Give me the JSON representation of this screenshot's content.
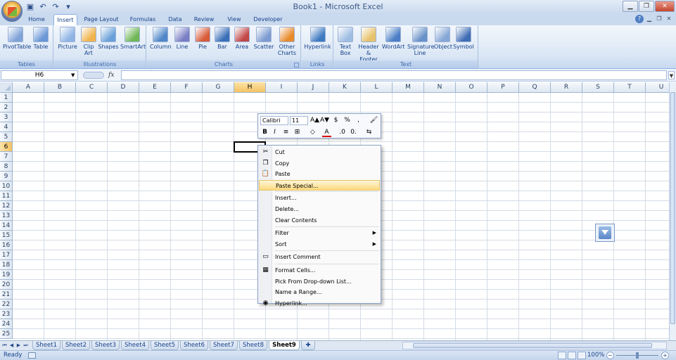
{
  "window": {
    "title": "Book1 - Microsoft Excel",
    "controls": [
      "minimize",
      "restore",
      "close"
    ]
  },
  "quick_access": [
    {
      "name": "save-icon",
      "glyph": "▣"
    },
    {
      "name": "undo-icon",
      "glyph": "↶"
    },
    {
      "name": "redo-icon",
      "glyph": "↷"
    },
    {
      "name": "customize-icon",
      "glyph": "▾"
    }
  ],
  "ribbon_tabs": [
    "Home",
    "Insert",
    "Page Layout",
    "Formulas",
    "Data",
    "Review",
    "View",
    "Developer"
  ],
  "ribbon_active_tab": "Insert",
  "ribbon_groups": [
    {
      "label": "Tables",
      "buttons": [
        "PivotTable",
        "Table"
      ]
    },
    {
      "label": "Illustrations",
      "buttons": [
        "Picture",
        "Clip Art",
        "Shapes",
        "SmartArt"
      ]
    },
    {
      "label": "Charts",
      "buttons": [
        "Column",
        "Line",
        "Pie",
        "Bar",
        "Area",
        "Scatter",
        "Other Charts"
      ]
    },
    {
      "label": "Links",
      "buttons": [
        "Hyperlink"
      ]
    },
    {
      "label": "Text",
      "buttons": [
        "Text Box",
        "Header & Footer",
        "WordArt",
        "Signature Line",
        "Object",
        "Symbol"
      ]
    }
  ],
  "formula_bar": {
    "name_box": "H6",
    "fx": "fx",
    "value": ""
  },
  "columns": [
    "A",
    "B",
    "C",
    "D",
    "E",
    "F",
    "G",
    "H",
    "I",
    "J",
    "K",
    "L",
    "M",
    "N",
    "O",
    "P",
    "Q",
    "R",
    "S",
    "T",
    "U"
  ],
  "rows": [
    "1",
    "2",
    "3",
    "4",
    "5",
    "6",
    "7",
    "8",
    "9",
    "10",
    "11",
    "12",
    "13",
    "14",
    "15",
    "16",
    "17",
    "18",
    "19",
    "20",
    "21",
    "22",
    "23",
    "24",
    "25"
  ],
  "selected_cell": {
    "column": "H",
    "row": "6"
  },
  "mini_toolbar": {
    "font": "Calibri",
    "size": "11",
    "buttons": [
      "A▲",
      "A▼",
      "$",
      "%",
      ",",
      "🖌",
      "B",
      "I",
      "≡",
      "⊞",
      "◇",
      "A",
      ".0",
      "0.",
      "⇆"
    ]
  },
  "context_menu": [
    {
      "label": "Cut",
      "icon": "✂",
      "name": "cut"
    },
    {
      "label": "Copy",
      "icon": "❐",
      "name": "copy"
    },
    {
      "label": "Paste",
      "icon": "📋",
      "name": "paste"
    },
    {
      "label": "Paste Special...",
      "icon": "",
      "name": "paste-special",
      "highlight": true
    },
    {
      "sep": true
    },
    {
      "label": "Insert...",
      "icon": "",
      "name": "insert"
    },
    {
      "label": "Delete...",
      "icon": "",
      "name": "delete"
    },
    {
      "label": "Clear Contents",
      "icon": "",
      "name": "clear-contents"
    },
    {
      "sep": true
    },
    {
      "label": "Filter",
      "icon": "",
      "name": "filter",
      "submenu": true
    },
    {
      "label": "Sort",
      "icon": "",
      "name": "sort",
      "submenu": true
    },
    {
      "sep": true
    },
    {
      "label": "Insert Comment",
      "icon": "▭",
      "name": "insert-comment"
    },
    {
      "sep": true
    },
    {
      "label": "Format Cells...",
      "icon": "▦",
      "name": "format-cells"
    },
    {
      "label": "Pick From Drop-down List...",
      "icon": "",
      "name": "pick-list"
    },
    {
      "label": "Name a Range...",
      "icon": "",
      "name": "name-range"
    },
    {
      "label": "Hyperlink...",
      "icon": "◉",
      "name": "hyperlink"
    }
  ],
  "sheet_tabs": [
    "Sheet1",
    "Sheet2",
    "Sheet3",
    "Sheet4",
    "Sheet5",
    "Sheet6",
    "Sheet7",
    "Sheet8",
    "Sheet9"
  ],
  "active_sheet": "Sheet9",
  "status": {
    "text": "Ready",
    "zoom": "100%"
  },
  "colors": {
    "accent": "#15428b",
    "ribbon": "#dbe7f5",
    "selection": "#f5c263",
    "highlight": "#fcd97f"
  }
}
